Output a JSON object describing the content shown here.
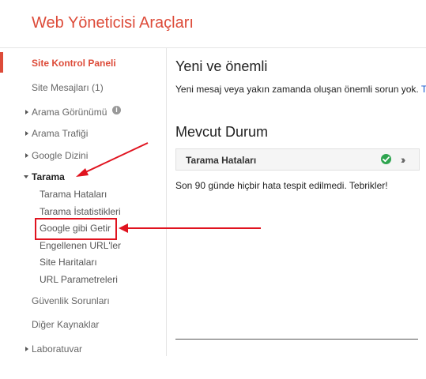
{
  "app": {
    "title": "Web Yöneticisi Araçları"
  },
  "sidebar": {
    "items": [
      {
        "label": "Site Kontrol Paneli"
      },
      {
        "label": "Site Mesajları (1)"
      },
      {
        "label": "Arama Görünümü"
      },
      {
        "label": "Arama Trafiği"
      },
      {
        "label": "Google Dizini"
      },
      {
        "label": "Tarama"
      },
      {
        "label": "Güvenlik Sorunları"
      },
      {
        "label": "Diğer Kaynaklar"
      },
      {
        "label": "Laboratuvar"
      }
    ],
    "info_glyph": "i",
    "tarama_sub": [
      {
        "label": "Tarama Hataları"
      },
      {
        "label": "Tarama İstatistikleri"
      },
      {
        "label": "Google gibi Getir"
      },
      {
        "label": "Engellenen URL'ler"
      },
      {
        "label": "Site Haritaları"
      },
      {
        "label": "URL Parametreleri"
      }
    ]
  },
  "main": {
    "new_title": "Yeni ve önemli",
    "new_text": "Yeni mesaj veya yakın zamanda oluşan önemli sorun yok.",
    "new_link": "T",
    "status_title": "Mevcut Durum",
    "status_bar_label": "Tarama Hataları",
    "status_text": "Son 90 günde hiçbir hata tespit edilmedi. Tebrikler!"
  },
  "colors": {
    "accent": "#dd4b39",
    "annotation": "#e0131f",
    "ok": "#2ea44f"
  }
}
